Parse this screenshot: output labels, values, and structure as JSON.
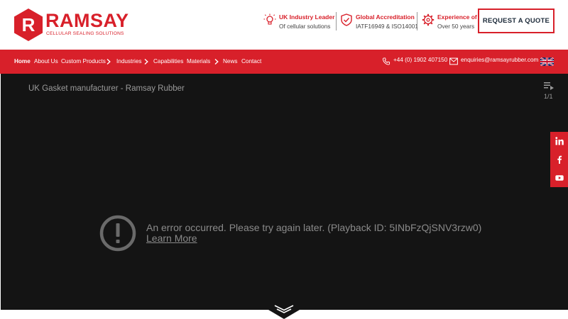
{
  "brand": {
    "name": "RAMSAY",
    "tagline": "CELLULAR SEALING SOLUTIONS",
    "logo_letter": "R",
    "color": "#d8202a"
  },
  "features": [
    {
      "title": "UK Industry Leader",
      "subtitle": "Of cellular solutions",
      "icon": "lightbulb-icon"
    },
    {
      "title": "Global Accreditation",
      "subtitle": "IATF16949 & ISO14001",
      "icon": "shield-check-icon"
    },
    {
      "title": "Experience of",
      "subtitle": "Over 50 years",
      "icon": "gear-icon"
    }
  ],
  "quote_button": "REQUEST A QUOTE",
  "nav": {
    "items": [
      "Home",
      "About Us",
      "Custom Products",
      "Industries",
      "Capabilities",
      "Materials",
      "News",
      "Contact"
    ],
    "phone": "+44 (0) 1902 407150",
    "email": "enquiries@ramsayrubber.com",
    "language": "uk-flag-icon"
  },
  "video": {
    "title": "UK Gasket manufacturer - Ramsay Rubber",
    "playlist_count": "1/1",
    "error_message": "An error occurred. Please try again later. (Playback ID: 5INbFzQjSNV3rzw0)",
    "learn_more": "Learn More"
  },
  "social": [
    "linkedin-icon",
    "facebook-icon",
    "youtube-icon"
  ],
  "scroll_icon": "chevron-down-icon"
}
